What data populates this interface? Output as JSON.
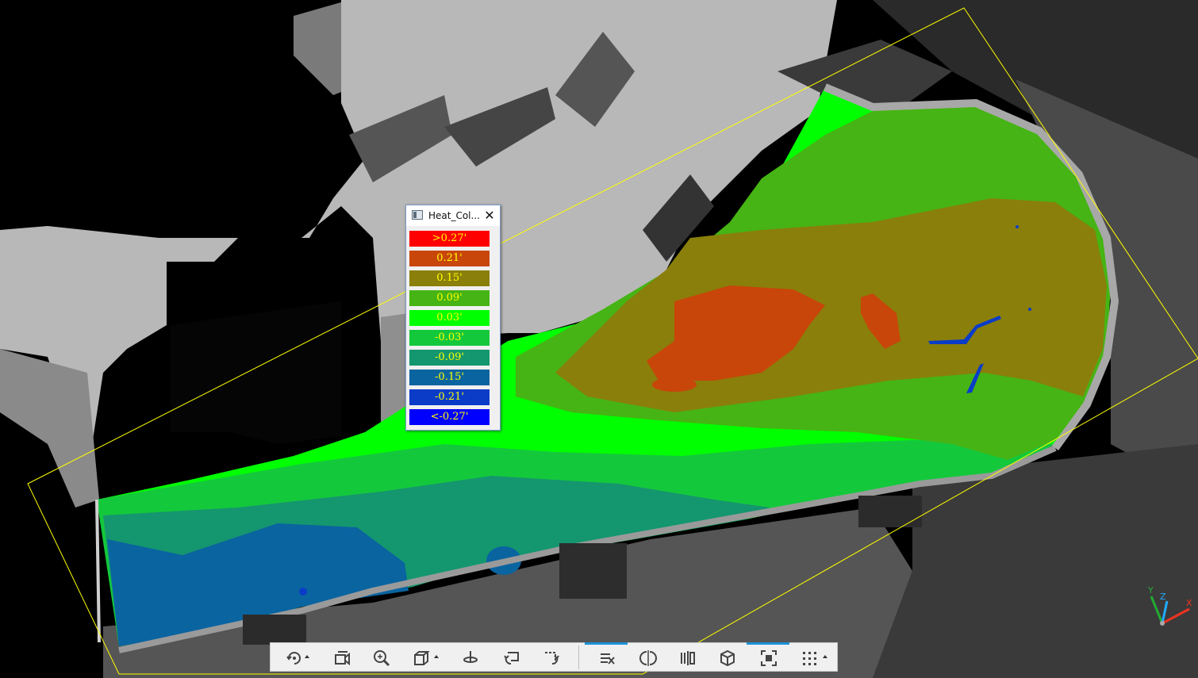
{
  "legend": {
    "title": "Heat_Col...",
    "close_glyph": "✕",
    "items": [
      {
        "label": ">0.27'",
        "color": "#ff0000"
      },
      {
        "label": "0.21'",
        "color": "#c8460a"
      },
      {
        "label": "0.15'",
        "color": "#8a7f0a"
      },
      {
        "label": "0.09'",
        "color": "#46b414"
      },
      {
        "label": "0.03'",
        "color": "#00ff00"
      },
      {
        "label": "-0.03'",
        "color": "#14c83c"
      },
      {
        "label": "-0.09'",
        "color": "#14966e"
      },
      {
        "label": "-0.15'",
        "color": "#0a64a0"
      },
      {
        "label": "-0.21'",
        "color": "#0a3cc8"
      },
      {
        "label": "<-0.27'",
        "color": "#0000ff"
      }
    ],
    "text_color": "#ffff00"
  },
  "toolbar": {
    "buttons": [
      {
        "icon": "orbit-icon",
        "has_dropdown": true,
        "active": false
      },
      {
        "icon": "pan-camera-icon",
        "has_dropdown": false,
        "active": false
      },
      {
        "icon": "zoom-icon",
        "has_dropdown": false,
        "active": false
      },
      {
        "icon": "view-cube-icon",
        "has_dropdown": true,
        "active": false
      },
      {
        "icon": "walk-icon",
        "has_dropdown": false,
        "active": false
      },
      {
        "icon": "undo-view-icon",
        "has_dropdown": false,
        "active": false
      },
      {
        "icon": "redo-view-icon",
        "has_dropdown": false,
        "active": false
      },
      {
        "icon": "clip-plane-icon",
        "has_dropdown": false,
        "active": true
      },
      {
        "icon": "section-icon",
        "has_dropdown": false,
        "active": false
      },
      {
        "icon": "slice-icon",
        "has_dropdown": false,
        "active": false
      },
      {
        "icon": "box-clip-icon",
        "has_dropdown": false,
        "active": false
      },
      {
        "icon": "fit-view-icon",
        "has_dropdown": false,
        "active": true
      },
      {
        "icon": "grid-icon",
        "has_dropdown": true,
        "active": false
      }
    ]
  },
  "triad": {
    "y_label": "Y",
    "z_label": "Z",
    "x_label": "X"
  },
  "colors": {
    "clip_box": "#ffff00",
    "accent": "#1e90d8"
  }
}
